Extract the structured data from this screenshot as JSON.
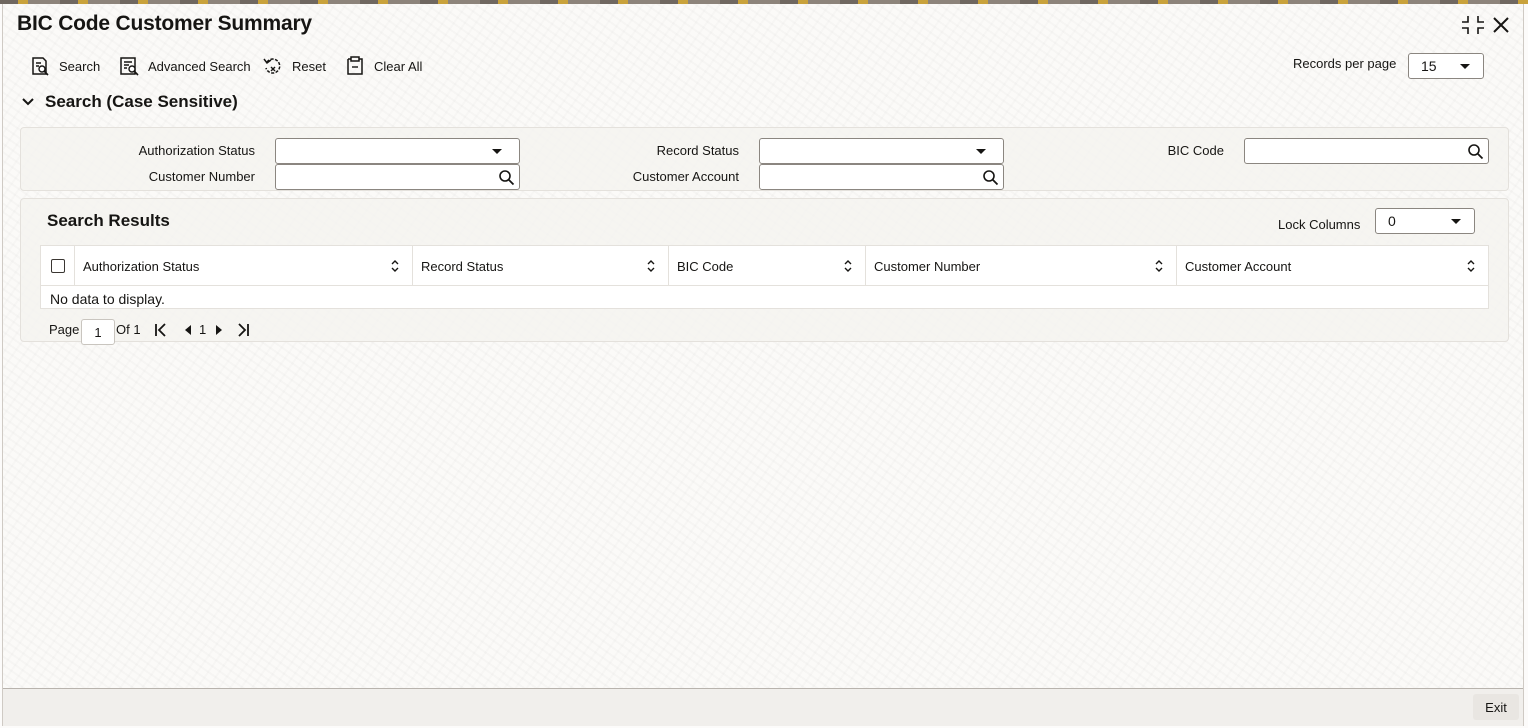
{
  "window": {
    "title": "BIC Code Customer Summary"
  },
  "toolbar": {
    "search": "Search",
    "advanced_search": "Advanced Search",
    "reset": "Reset",
    "clear_all": "Clear All",
    "records_per_page_label": "Records per page",
    "records_per_page_value": "15"
  },
  "search_section": {
    "title": "Search (Case Sensitive)",
    "fields": {
      "authorization_status": {
        "label": "Authorization Status",
        "value": ""
      },
      "record_status": {
        "label": "Record Status",
        "value": ""
      },
      "bic_code": {
        "label": "BIC Code",
        "value": ""
      },
      "customer_number": {
        "label": "Customer Number",
        "value": ""
      },
      "customer_account": {
        "label": "Customer Account",
        "value": ""
      }
    }
  },
  "results": {
    "title": "Search Results",
    "lock_columns_label": "Lock Columns",
    "lock_columns_value": "0",
    "columns": [
      "Authorization Status",
      "Record Status",
      "BIC Code",
      "Customer Number",
      "Customer Account"
    ],
    "rows": [],
    "empty_message": "No data to display."
  },
  "pagination": {
    "page_label": "Page",
    "current_page": "1",
    "of_label": "Of 1",
    "page_link": "1"
  },
  "footer": {
    "exit": "Exit"
  },
  "icons": {
    "window_controls": [
      "collapse-icon",
      "close-icon"
    ],
    "toolbar": [
      "search-doc-icon",
      "advanced-search-icon",
      "reset-icon",
      "clear-all-icon"
    ],
    "pagination": [
      "first-page-icon",
      "prev-page-icon",
      "next-page-icon",
      "last-page-icon"
    ]
  }
}
